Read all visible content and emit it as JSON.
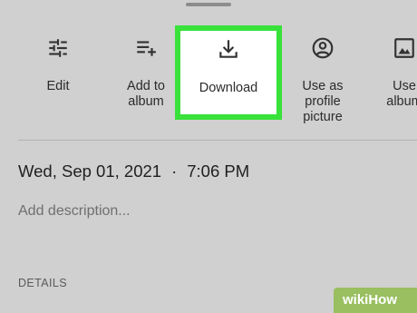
{
  "actions": [
    {
      "label": "Edit",
      "icon": "tune-sliders-icon"
    },
    {
      "label": "Add to\nalbum",
      "icon": "playlist-add-icon"
    },
    {
      "label": "Download",
      "icon": "download-icon"
    },
    {
      "label": "Use as\nprofile\npicture",
      "icon": "account-circle-icon"
    },
    {
      "label": "Use\nalbum",
      "icon": "image-icon"
    }
  ],
  "photo_info": {
    "date": "Wed, Sep 01, 2021",
    "separator": "·",
    "time": "7:06 PM",
    "description_placeholder": "Add description...",
    "details_heading": "DETAILS"
  },
  "watermark": "wikiHow",
  "colors": {
    "highlight_border": "#38e23a",
    "background": "#d0d0d0",
    "text": "#2b2b2b"
  }
}
